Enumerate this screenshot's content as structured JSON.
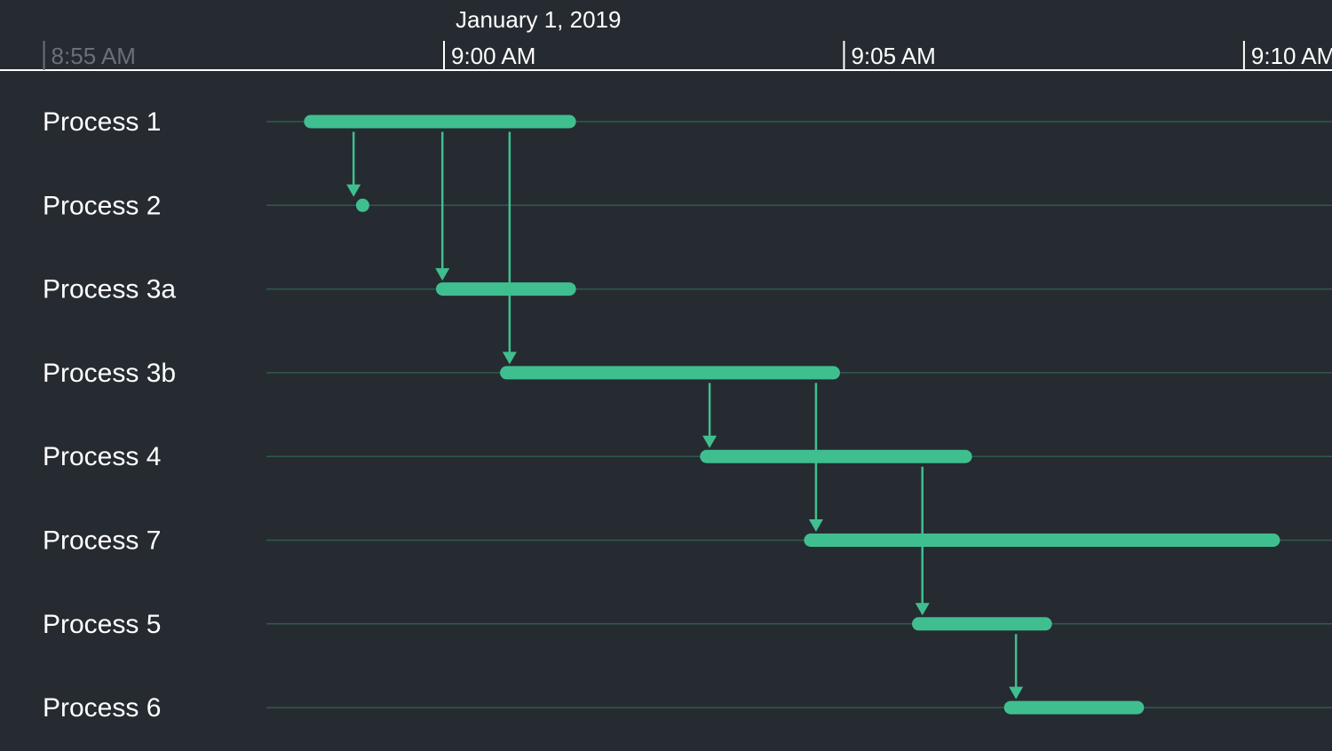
{
  "chart_data": {
    "type": "gantt",
    "date_label": "January 1, 2019",
    "time_axis": {
      "range": [
        "8:55 AM",
        "9:10 AM"
      ],
      "ticks": [
        {
          "label": "8:55 AM",
          "minute": 0,
          "muted": true
        },
        {
          "label": "9:00 AM",
          "minute": 5,
          "muted": false
        },
        {
          "label": "9:05 AM",
          "minute": 10,
          "muted": false
        },
        {
          "label": "9:10 AM",
          "minute": 15,
          "muted": false
        }
      ],
      "visible_start_minute": -0.55,
      "visible_end_minute": 16.1
    },
    "tasks": [
      {
        "name": "Process 1",
        "start": 3.25,
        "end": 6.65
      },
      {
        "name": "Process 2",
        "start": 3.9,
        "end": 4.05
      },
      {
        "name": "Process 3a",
        "start": 4.9,
        "end": 6.65
      },
      {
        "name": "Process 3b",
        "start": 5.7,
        "end": 9.95
      },
      {
        "name": "Process 4",
        "start": 8.2,
        "end": 11.6
      },
      {
        "name": "Process 7",
        "start": 9.5,
        "end": 15.45
      },
      {
        "name": "Process 5",
        "start": 10.85,
        "end": 12.6
      },
      {
        "name": "Process 6",
        "start": 12.0,
        "end": 13.75
      }
    ],
    "dependencies": [
      {
        "from": "Process 1",
        "to": "Process 2",
        "at": 3.87
      },
      {
        "from": "Process 1",
        "to": "Process 3a",
        "at": 4.98
      },
      {
        "from": "Process 1",
        "to": "Process 3b",
        "at": 5.82
      },
      {
        "from": "Process 3b",
        "to": "Process 4",
        "at": 8.32
      },
      {
        "from": "Process 3b",
        "to": "Process 7",
        "at": 9.65
      },
      {
        "from": "Process 4",
        "to": "Process 5",
        "at": 10.98
      },
      {
        "from": "Process 5",
        "to": "Process 6",
        "at": 12.15
      }
    ],
    "colors": {
      "background": "#262b31",
      "bar": "#3fbf8f",
      "dependency": "#3fbf8f",
      "row_line": "#2f5a4f",
      "axis_line": "#ffffff",
      "tick": "#ffffff",
      "tick_muted": "#6b7078",
      "text": "#ffffff"
    }
  }
}
